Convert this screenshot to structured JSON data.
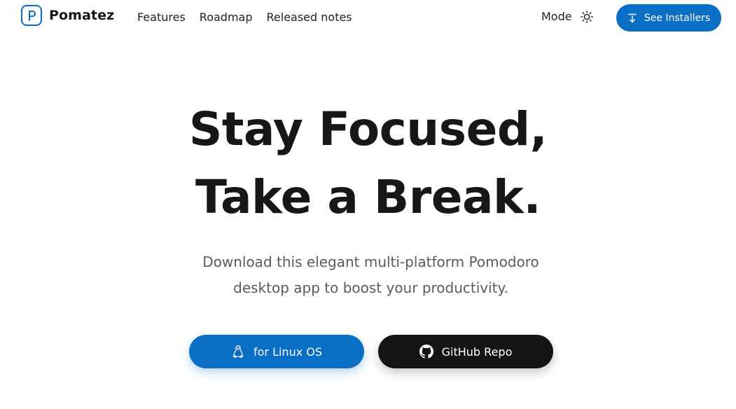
{
  "brand": {
    "name": "Pomatez",
    "logo_icon": "pomatez-logo-icon"
  },
  "nav": {
    "items": [
      {
        "label": "Features"
      },
      {
        "label": "Roadmap"
      },
      {
        "label": "Released notes"
      }
    ]
  },
  "mode": {
    "label": "Mode",
    "icon": "sun-icon"
  },
  "header_cta": {
    "label": "See Installers",
    "icon": "download-icon"
  },
  "hero": {
    "title_line_1": "Stay Focused,",
    "title_line_2": "Take a Break.",
    "subtitle": "Download this elegant multi-platform Pomodoro desktop app to boost your productivity.",
    "primary_button": {
      "label": "for Linux OS",
      "icon": "linux-icon"
    },
    "secondary_button": {
      "label": "GitHub Repo",
      "icon": "github-icon"
    }
  },
  "colors": {
    "accent": "#0b6ec5",
    "dark_button": "#141414",
    "text": "#171717",
    "muted_text": "#5b5b5b"
  }
}
